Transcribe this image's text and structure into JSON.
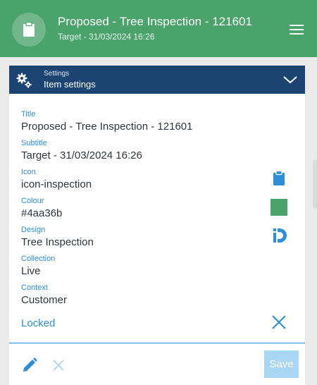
{
  "header": {
    "title": "Proposed - Tree Inspection - 121601",
    "subtitle": "Target - 31/03/2024 16:26",
    "avatar_icon": "clipboard-icon",
    "menu_icon": "hamburger-menu-icon"
  },
  "settings": {
    "small_label": "Settings",
    "main_label": "Item settings",
    "icon": "gears-icon",
    "toggle_icon": "chevron-down-icon"
  },
  "fields": {
    "title": {
      "label": "Title",
      "value": "Proposed - Tree Inspection - 121601"
    },
    "subtitle": {
      "label": "Subtitle",
      "value": "Target - 31/03/2024 16:26"
    },
    "icon": {
      "label": "Icon",
      "value": "icon-inspection"
    },
    "colour": {
      "label": "Colour",
      "value": "#4aa36b"
    },
    "design": {
      "label": "Design",
      "value": "Tree Inspection"
    },
    "collection": {
      "label": "Collection",
      "value": "Live"
    },
    "context": {
      "label": "Context",
      "value": "Customer"
    }
  },
  "locked": {
    "label": "Locked",
    "icon": "close-icon"
  },
  "footer": {
    "edit_icon": "pencil-icon",
    "cancel_icon": "close-icon",
    "save_label": "Save"
  },
  "colors": {
    "header_bg": "#4aa36b",
    "settings_bg": "#1b4472",
    "accent": "#2e8ed8",
    "swatch": "#4aa36b",
    "save_bg": "#a9d6f2"
  }
}
